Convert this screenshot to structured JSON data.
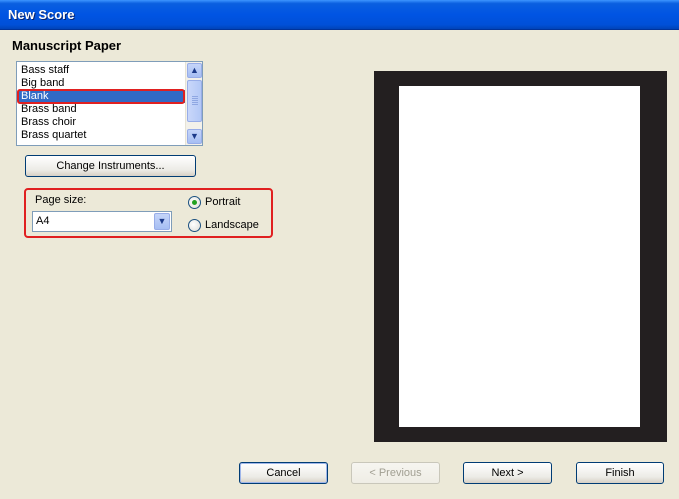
{
  "window": {
    "title": "New Score"
  },
  "section": {
    "heading": "Manuscript Paper"
  },
  "paper_list": {
    "items": [
      "Bass staff",
      "Big band",
      "Blank",
      "Brass band",
      "Brass choir",
      "Brass quartet"
    ],
    "selected_index": 2
  },
  "buttons": {
    "change_instruments": "Change Instruments...",
    "cancel": "Cancel",
    "previous": "< Previous",
    "next": "Next >",
    "finish": "Finish"
  },
  "page_size": {
    "label": "Page size:",
    "value": "A4"
  },
  "orientation": {
    "portrait": "Portrait",
    "landscape": "Landscape",
    "selected": "Portrait"
  },
  "icons": {
    "scroll_up": "scroll-up-arrow-icon",
    "scroll_down": "scroll-down-arrow-icon",
    "dropdown": "chevron-down-icon"
  },
  "colors": {
    "titlebar": "#0054E3",
    "highlight": "#E02020",
    "selection": "#316AC5",
    "preview_frame": "#231F20"
  }
}
